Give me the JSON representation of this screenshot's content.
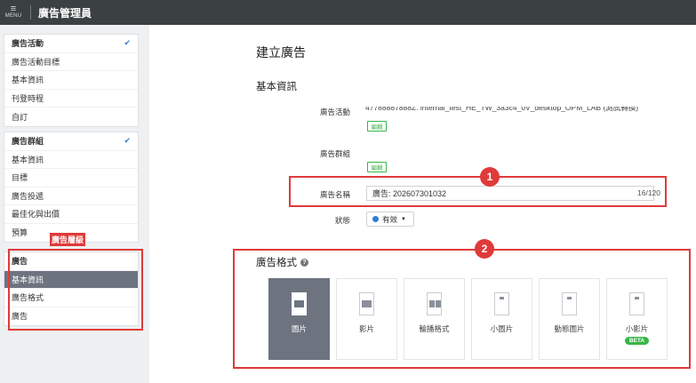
{
  "topbar": {
    "menu_icon": "≡",
    "menu_label": "MENU",
    "app_title": "廣告管理員"
  },
  "sidebar": {
    "campaign_group": [
      {
        "label": "廣告活動",
        "checked": true
      },
      {
        "label": "廣告活動目標"
      },
      {
        "label": "基本資訊"
      },
      {
        "label": "刊登時程"
      },
      {
        "label": "自訂"
      }
    ],
    "adgroup_group": [
      {
        "label": "廣告群組",
        "checked": true
      },
      {
        "label": "基本資訊"
      },
      {
        "label": "目標"
      },
      {
        "label": "廣告投遞"
      },
      {
        "label": "最佳化與出價"
      },
      {
        "label": "預算"
      }
    ],
    "ad_level_tag": "廣告層級",
    "ad_group": [
      {
        "label": "廣告"
      },
      {
        "label": "基本資訊",
        "active": true
      },
      {
        "label": "廣告格式"
      },
      {
        "label": "廣告"
      }
    ],
    "check_icon": "✔"
  },
  "main": {
    "page_title": "建立廣告",
    "section_title": "基本資訊",
    "campaign_label": "廣告活動",
    "campaign_value_partial": "47788887888Z. internal_test_HE_TW_3a3c4_0V_desktop_OPM_LAB (測試轉換)",
    "edit_label": "編輯",
    "adgroup_label": "廣告群組",
    "ad_name_label": "廣告名稱",
    "ad_name_value": "廣告: 202607301032",
    "char_count": "16/120",
    "status_label": "狀態",
    "status_value": "有效",
    "caret": "▼",
    "format_title": "廣告格式",
    "help_icon": "?",
    "formats": [
      {
        "label": "圖片",
        "selected": true
      },
      {
        "label": "影片"
      },
      {
        "label": "輪播格式"
      },
      {
        "label": "小圖片"
      },
      {
        "label": "動態圖片"
      },
      {
        "label": "小影片",
        "badge": "BETA"
      }
    ]
  },
  "annotations": {
    "badge1": "1",
    "badge2": "2"
  },
  "colors": {
    "accent_red": "#e03a3a",
    "edit_green": "#39b54a",
    "status_blue": "#2d7fd1",
    "topbar": "#3b4043",
    "selected_card": "#6d7480"
  }
}
